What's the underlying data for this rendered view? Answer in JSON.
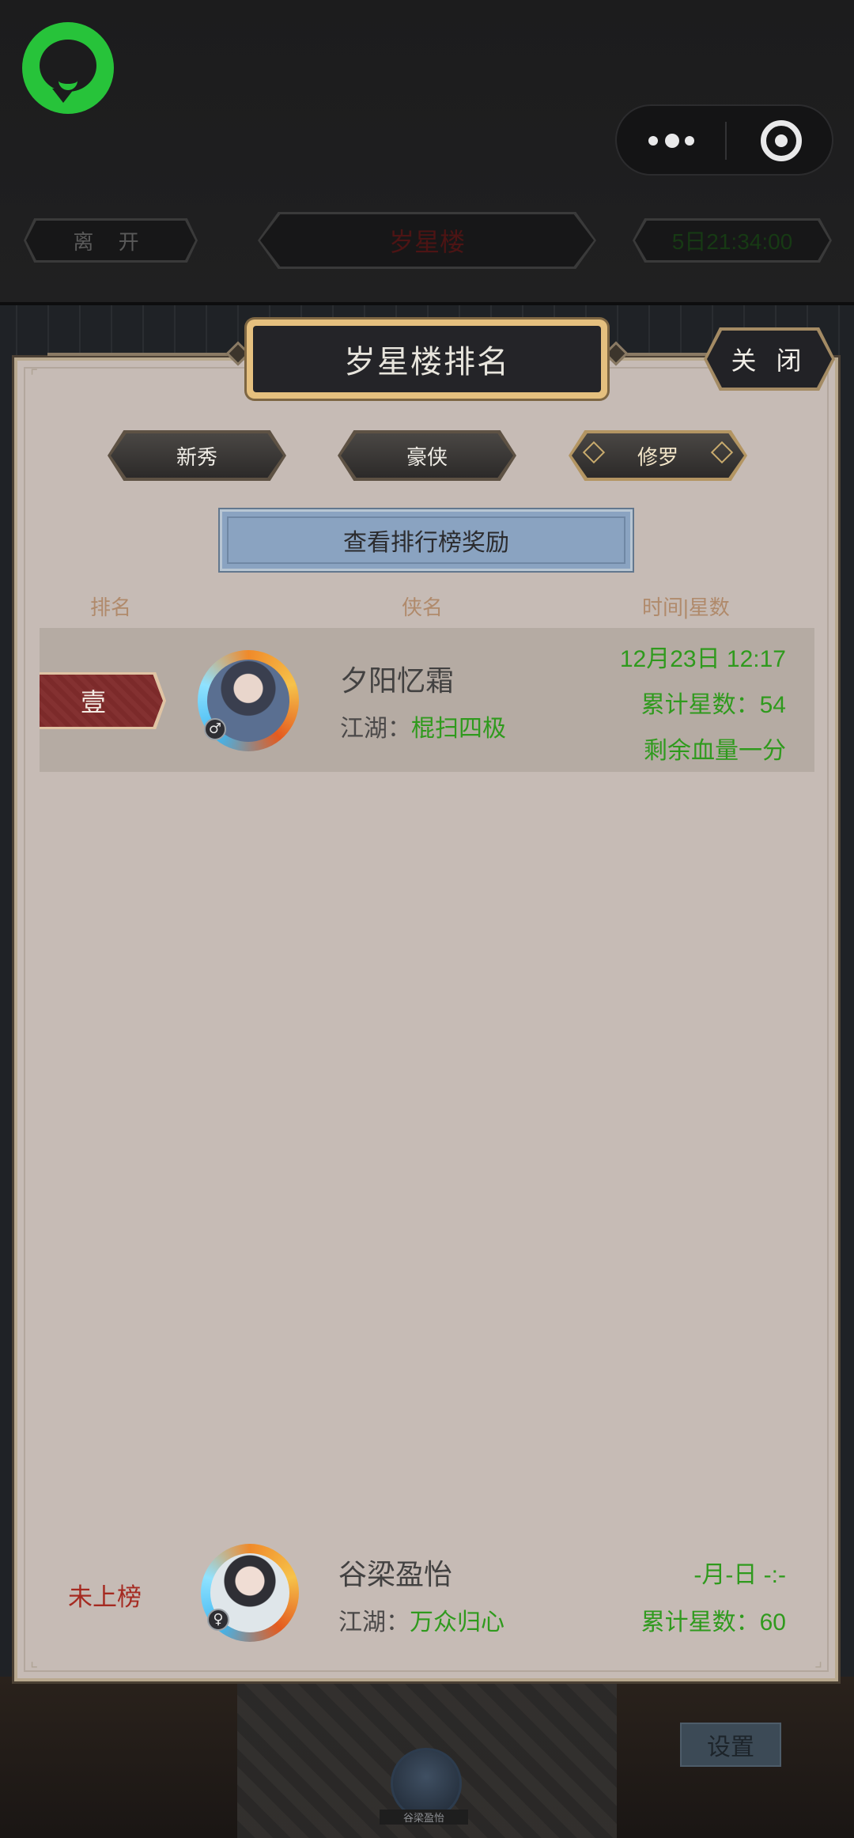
{
  "top_bar": {
    "leave_label": "离 开",
    "tower_title": "岁星楼",
    "countdown": "5日21:34:00"
  },
  "dialog": {
    "title": "岁星楼排名",
    "close_label": "关 闭",
    "tabs": [
      {
        "label": "新秀",
        "active": false
      },
      {
        "label": "豪侠",
        "active": false
      },
      {
        "label": "修罗",
        "active": true
      }
    ],
    "reward_button": "查看排行榜奖励",
    "columns": {
      "rank": "排名",
      "hero_name": "侠名",
      "time_stars": "时间|星数"
    },
    "ranking": [
      {
        "rank": "壹",
        "name": "夕阳忆霜",
        "gender": "♂",
        "jianghu_label": "江湖：",
        "jianghu_value": "棍扫四极",
        "time": "12月23日 12:17",
        "stars_text": "累计星数：54",
        "remaining": "剩余血量一分"
      }
    ],
    "self": {
      "rank": "未上榜",
      "name": "谷梁盈怡",
      "gender": "♀",
      "jianghu_label": "江湖：",
      "jianghu_value": "万众归心",
      "time": "-月-日 -:-",
      "stars_text": "累计星数：60"
    }
  },
  "background": {
    "settings_label": "设置",
    "avatar_name": "谷梁盈怡"
  },
  "colors": {
    "accent_green": "#2f9a1d",
    "rank_red": "#a52a21",
    "logo_green": "#27c33a",
    "panel_bg": "#c6bbb5"
  },
  "icons": {
    "app_logo": "chat-bubble-icon",
    "more": "more-dots-icon",
    "exit": "target-circle-icon"
  }
}
